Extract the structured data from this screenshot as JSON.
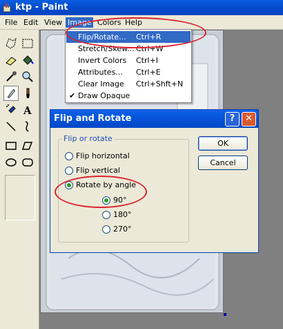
{
  "window": {
    "title": "ktp - Paint",
    "icon": "paint-app-icon"
  },
  "menubar": {
    "items": [
      "File",
      "Edit",
      "View",
      "Image",
      "Colors",
      "Help"
    ],
    "open_menu": "Image"
  },
  "image_menu": {
    "items": [
      {
        "label": "Flip/Rotate...",
        "shortcut": "Ctrl+R",
        "highlighted": true
      },
      {
        "label": "Stretch/Skew...",
        "shortcut": "Ctrl+W"
      },
      {
        "label": "Invert Colors",
        "shortcut": "Ctrl+I"
      },
      {
        "label": "Attributes...",
        "shortcut": "Ctrl+E"
      },
      {
        "label": "Clear Image",
        "shortcut": "Ctrl+Shft+N"
      },
      {
        "label": "Draw Opaque",
        "shortcut": "",
        "checked": true
      }
    ]
  },
  "toolbox": {
    "tools": [
      "free-form-select-icon",
      "select-icon",
      "eraser-icon",
      "fill-bucket-icon",
      "pick-color-icon",
      "magnifier-icon",
      "pencil-icon",
      "brush-icon",
      "airbrush-icon",
      "text-icon",
      "line-icon",
      "curve-icon",
      "rectangle-icon",
      "polygon-icon",
      "ellipse-icon",
      "rounded-rectangle-icon"
    ],
    "selected": "pencil-icon"
  },
  "dialog": {
    "title": "Flip and Rotate",
    "group_label": "Flip or rotate",
    "options": {
      "flip_horizontal": "Flip horizontal",
      "flip_vertical": "Flip vertical",
      "rotate": "Rotate by angle"
    },
    "selected_option": "Rotate by angle",
    "angles": [
      "90°",
      "180°",
      "270°"
    ],
    "selected_angle": "90°",
    "ok": "OK",
    "cancel": "Cancel",
    "help_glyph": "?",
    "close_glyph": "✕"
  },
  "annotation_color": "#d9232e"
}
